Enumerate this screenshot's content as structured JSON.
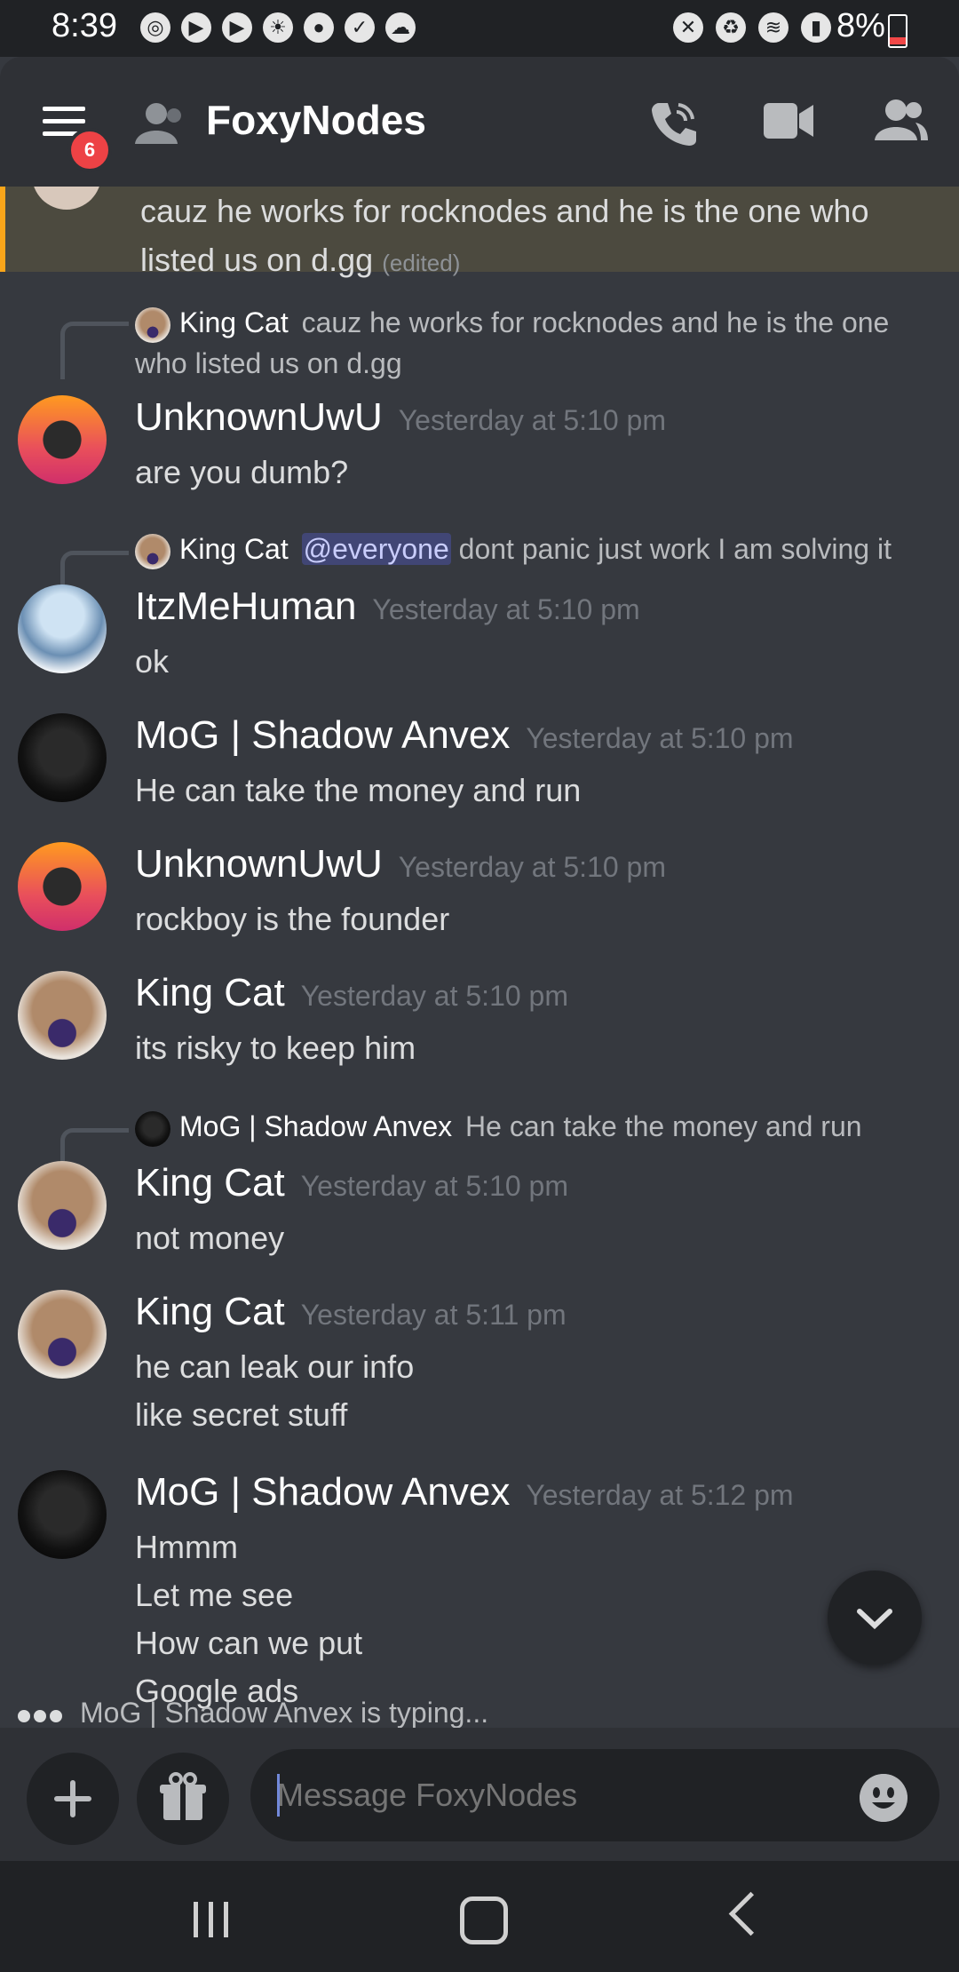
{
  "status_bar": {
    "time": "8:39",
    "battery": "8%"
  },
  "header": {
    "title": "FoxyNodes",
    "badge": "6"
  },
  "highlight": {
    "text": "cauz he works for rocknodes and he is the one who listed us on d.gg",
    "edited": "(edited)"
  },
  "messages": [
    {
      "reply": {
        "author": "King Cat",
        "text": "cauz he works for rocknodes and he is the one who listed us on d.gg"
      },
      "author": "UnknownUwU",
      "time": "Yesterday at 5:10 pm",
      "lines": [
        "are you dumb?"
      ]
    },
    {
      "reply": {
        "author": "King Cat",
        "mention": "@everyone",
        "text": "dont panic just work I am solving it"
      },
      "author": "ItzMeHuman",
      "time": "Yesterday at 5:10 pm",
      "lines": [
        "ok"
      ]
    },
    {
      "author": "MoG | Shadow Anvex",
      "time": "Yesterday at 5:10 pm",
      "lines": [
        "He can take the money and run"
      ]
    },
    {
      "author": "UnknownUwU",
      "time": "Yesterday at 5:10 pm",
      "lines": [
        "rockboy is the founder"
      ]
    },
    {
      "author": "King Cat",
      "time": "Yesterday at 5:10 pm",
      "lines": [
        "its risky to keep him"
      ]
    },
    {
      "reply": {
        "author": "MoG | Shadow Anvex",
        "text": "He can take the money and run"
      },
      "author": "King Cat",
      "time": "Yesterday at 5:10 pm",
      "lines": [
        "not money"
      ]
    },
    {
      "author": "King Cat",
      "time": "Yesterday at 5:11 pm",
      "lines": [
        "he can leak our info",
        "like secret stuff"
      ]
    },
    {
      "author": "MoG | Shadow Anvex",
      "time": "Yesterday at 5:12 pm",
      "lines": [
        "Hmmm",
        "Let me see",
        "How can we put",
        "Google ads"
      ]
    }
  ],
  "typing": "MoG | Shadow Anvex is typing...",
  "composer": {
    "placeholder": "Message FoxyNodes"
  }
}
